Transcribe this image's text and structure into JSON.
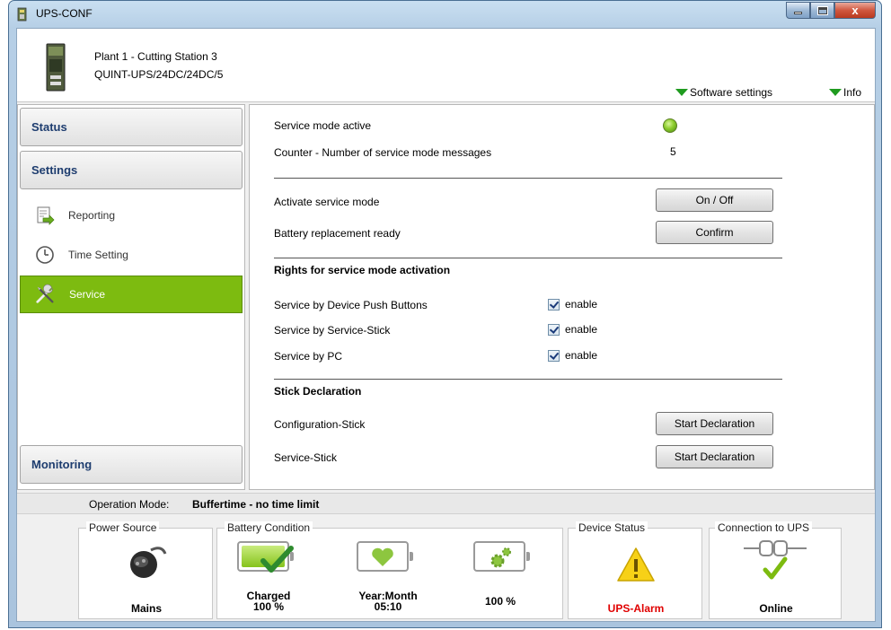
{
  "window": {
    "title": "UPS-CONF",
    "minimize_glyph": "minimize",
    "maximize_glyph": "maximize",
    "close_glyph": "x"
  },
  "header": {
    "device_location": "Plant 1 - Cutting Station 3",
    "device_model": "QUINT-UPS/24DC/24DC/5",
    "software_settings_link": "Software settings",
    "info_link": "Info"
  },
  "sidebar": {
    "status": "Status",
    "settings": "Settings",
    "items": [
      {
        "label": "Reporting",
        "icon": "reporting-icon"
      },
      {
        "label": "Time Setting",
        "icon": "clock-icon"
      },
      {
        "label": "Service",
        "icon": "tools-icon",
        "active": true
      }
    ],
    "monitoring": "Monitoring"
  },
  "service": {
    "service_mode_active_label": "Service mode active",
    "counter_label": "Counter - Number of service mode messages",
    "counter_value": "5",
    "activate_label": "Activate service mode",
    "activate_button": "On / Off",
    "battery_replacement_label": "Battery replacement ready",
    "confirm_button": "Confirm",
    "rights_title": "Rights for service mode activation",
    "rights": [
      {
        "label": "Service by Device Push Buttons",
        "checkbox": "enable",
        "checked": true
      },
      {
        "label": "Service by Service-Stick",
        "checkbox": "enable",
        "checked": true
      },
      {
        "label": "Service by PC",
        "checkbox": "enable",
        "checked": true
      }
    ],
    "stick_title": "Stick Declaration",
    "sticks": [
      {
        "label": "Configuration-Stick",
        "button": "Start Declaration"
      },
      {
        "label": "Service-Stick",
        "button": "Start Declaration"
      }
    ]
  },
  "operation": {
    "label": "Operation Mode:",
    "value": "Buffertime - no time limit"
  },
  "status_boxes": {
    "power_source": {
      "title": "Power Source",
      "value": "Mains"
    },
    "battery_condition": {
      "title": "Battery Condition",
      "charged_label": "Charged",
      "charged_value": "100 %",
      "age_label": "Year:Month",
      "age_value": "05:10",
      "health_value": "100 %"
    },
    "device_status": {
      "title": "Device Status",
      "value": "UPS-Alarm",
      "value_color": "#e00000"
    },
    "connection": {
      "title": "Connection to UPS",
      "value": "Online"
    }
  },
  "colors": {
    "accent_green": "#7dbb10",
    "nav_text": "#1e3d6f",
    "alarm_red": "#e00000"
  }
}
